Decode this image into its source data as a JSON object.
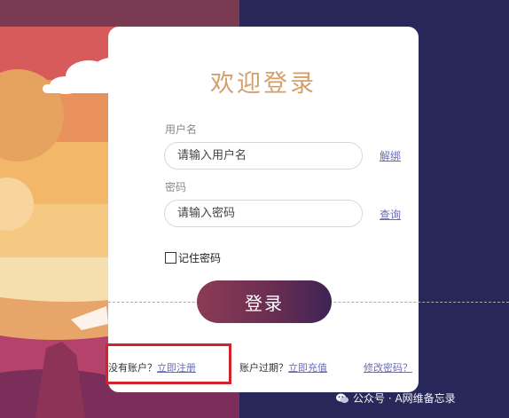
{
  "login": {
    "title": "欢迎登录",
    "username_label": "用户名",
    "username_placeholder": "请输入用户名",
    "bind_link": "解绑",
    "password_label": "密码",
    "password_placeholder": "请输入密码",
    "query_link": "查询",
    "remember_label": "记住密码",
    "login_button": "登录"
  },
  "footer": {
    "no_account": "没有账户？",
    "register_link": "立即注册",
    "expired": "账户过期？",
    "recharge_link": "立即充值",
    "change_password_link": "修改密码？"
  },
  "watermark": {
    "text": "公众号 · A网维备忘录",
    "icon": "wechat-icon"
  },
  "colors": {
    "background": "#27275a",
    "title": "#d3a06a",
    "link": "#6b6bb5",
    "button_start": "#8c3b55",
    "button_end": "#3e2355",
    "highlight": "#d0232a"
  }
}
